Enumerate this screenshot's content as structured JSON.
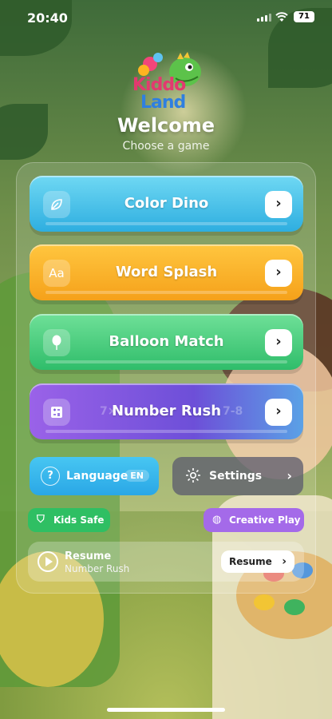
{
  "status": {
    "time": "20:40",
    "battery": "71"
  },
  "logo": {
    "line1": "Kiddo",
    "line2": "Land"
  },
  "header": {
    "title": "Welcome",
    "subtitle": "Choose a game"
  },
  "games": [
    {
      "label": "Color Dino",
      "icon": "leaf-icon"
    },
    {
      "label": "Word Splash",
      "icon": "aa-icon",
      "icon_text": "Aa"
    },
    {
      "label": "Balloon Match",
      "icon": "balloon-icon"
    },
    {
      "label": "Number Rush",
      "icon": "calculator-icon",
      "decor_left": "7×",
      "decor_right": "7-8"
    }
  ],
  "language": {
    "label": "Language",
    "value": "EN"
  },
  "settings": {
    "label": "Settings"
  },
  "badges": {
    "safe": "Kids Safe",
    "creative": "Creative Play"
  },
  "resume": {
    "title": "Resume",
    "subtitle": "Number Rush",
    "button": "Resume"
  },
  "colors": {
    "blue": "#2eaee0",
    "orange": "#f5a11a",
    "green": "#2fbd6a",
    "purple": "#8a59e3"
  }
}
